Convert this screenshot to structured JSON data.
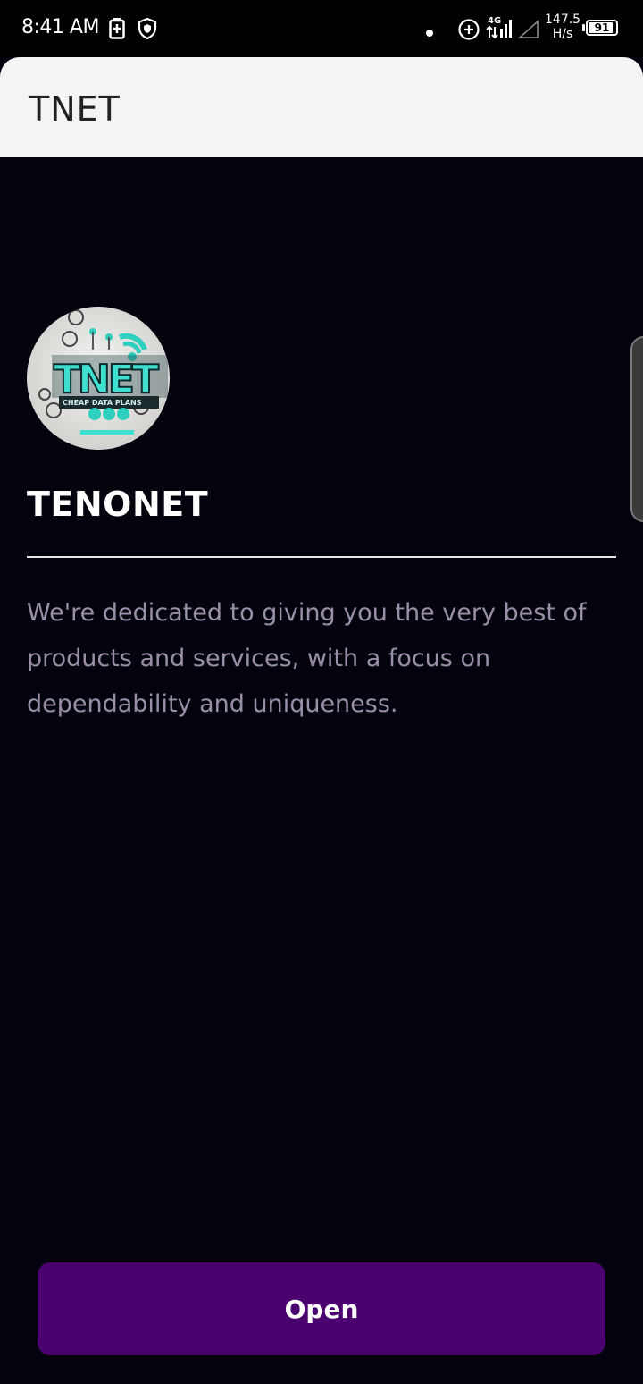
{
  "status_bar": {
    "time": "8:41 AM",
    "network_type": "4G",
    "speed_value": "147.5",
    "speed_unit": "H/s",
    "battery_percent": "91"
  },
  "app_bar": {
    "title": "TNET"
  },
  "profile": {
    "logo_text": "TNET",
    "logo_tagline": "CHEAP DATA PLANS",
    "name": "TENONET",
    "description": "We're dedicated to giving you the very best of products and services, with a focus on dependability and uniqueness."
  },
  "actions": {
    "open_label": "Open"
  },
  "colors": {
    "background": "#04020c",
    "app_bar": "#f4f4f4",
    "button": "#4a006f",
    "description_text": "#9a8fa8",
    "logo_accent": "#3fe0cf"
  },
  "icons": [
    "battery-saver-icon",
    "shield-icon",
    "dot-icon",
    "data-saver-icon",
    "signal-icon",
    "signal-empty-icon",
    "battery-icon"
  ]
}
